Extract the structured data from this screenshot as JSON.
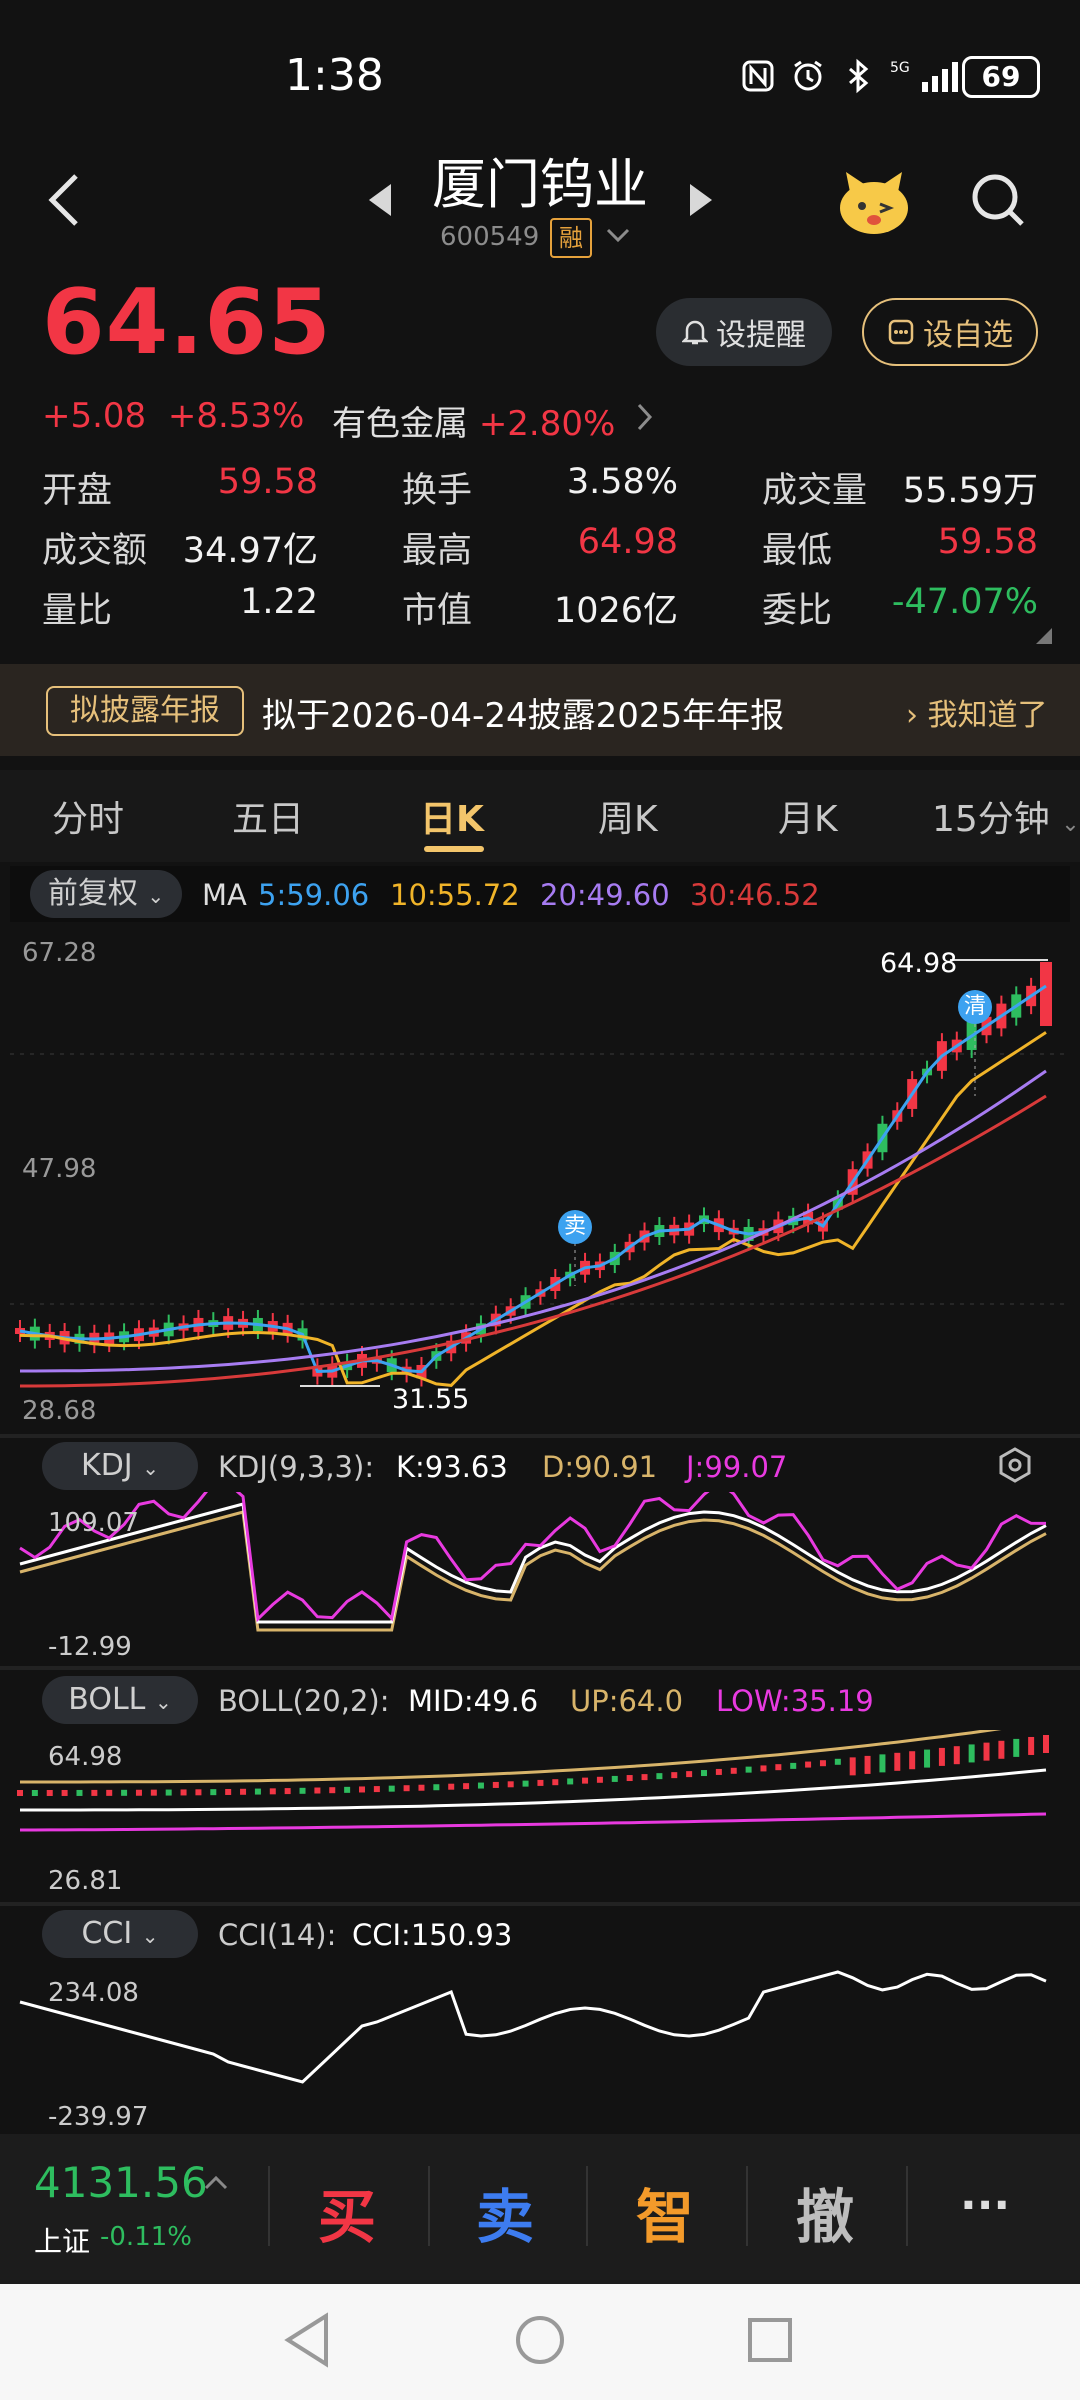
{
  "status_bar": {
    "time": "1:38",
    "battery": "69",
    "signal": "5G"
  },
  "header": {
    "stock_name": "厦门钨业",
    "stock_code": "600549",
    "margin_tag": "融"
  },
  "quote": {
    "price": "64.65",
    "change": "+5.08",
    "change_pct": "+8.53%",
    "sector": "有色金属",
    "sector_change": "+2.80%",
    "alert_btn": "设提醒",
    "watch_btn": "设自选",
    "stats": [
      {
        "label": "开盘",
        "value": "59.58",
        "color": "red"
      },
      {
        "label": "换手",
        "value": "3.58%",
        "color": "white"
      },
      {
        "label": "成交量",
        "value": "55.59万",
        "color": "white"
      },
      {
        "label": "成交额",
        "value": "34.97亿",
        "color": "white"
      },
      {
        "label": "最高",
        "value": "64.98",
        "color": "red"
      },
      {
        "label": "最低",
        "value": "59.58",
        "color": "red"
      },
      {
        "label": "量比",
        "value": "1.22",
        "color": "white"
      },
      {
        "label": "市值",
        "value": "1026亿",
        "color": "white"
      },
      {
        "label": "委比",
        "value": "-47.07%",
        "color": "green"
      }
    ]
  },
  "notice": {
    "tag": "拟披露年报",
    "text": "拟于2026-04-24披露2025年年报",
    "action": "我知道了"
  },
  "tabs": [
    "分时",
    "五日",
    "日K",
    "周K",
    "月K",
    "15分钟"
  ],
  "ma": {
    "adjust": "前复权",
    "label": "MA",
    "ma5": "5:59.06",
    "ma10": "10:55.72",
    "ma20": "20:49.60",
    "ma30": "30:46.52"
  },
  "kline": {
    "y_top": "67.28",
    "y_mid": "47.98",
    "y_bottom": "28.68",
    "high_label": "64.98",
    "low_label": "31.55",
    "sell_mark": "卖",
    "clear_mark": "清"
  },
  "kdj": {
    "name": "KDJ",
    "params": "KDJ(9,3,3):",
    "k": "K:93.63",
    "d": "D:90.91",
    "j": "J:99.07",
    "y_top": "109.07",
    "y_bottom": "-12.99"
  },
  "boll": {
    "name": "BOLL",
    "params": "BOLL(20,2):",
    "mid": "MID:49.6",
    "up": "UP:64.0",
    "low": "LOW:35.19",
    "y_top": "64.98",
    "y_bottom": "26.81"
  },
  "cci": {
    "name": "CCI",
    "params": "CCI(14):",
    "value": "CCI:150.93",
    "y_top": "234.08",
    "y_bottom": "-239.97"
  },
  "bottom": {
    "index_value": "4131.56",
    "index_name": "上证",
    "index_change": "-0.11%",
    "buy": "买",
    "sell": "卖",
    "smart": "智",
    "cancel": "撤",
    "more": "···"
  },
  "colors": {
    "up": "#f23645",
    "down": "#2ebd5f",
    "accent": "#f3c56b",
    "ma5": "#3da2f0",
    "ma10": "#f0b429",
    "ma20": "#a77cf2",
    "ma30": "#d83a3a"
  }
}
